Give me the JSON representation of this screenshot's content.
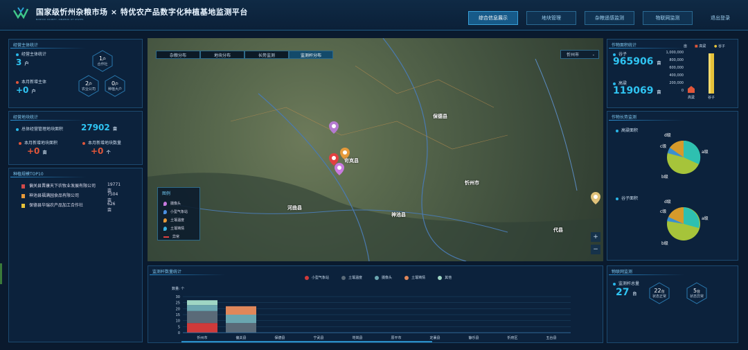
{
  "header": {
    "title": "国家级忻州杂粮市场 × 特优农产品数字化种植基地监测平台",
    "subtitle": "BANYOU COUNTY, XINZHOU OF STATES",
    "nav": [
      "综合信息展示",
      "地块管理",
      "杂粮遥感监测",
      "物联网监测",
      "退出登录"
    ]
  },
  "business": {
    "title": "经营主体统计",
    "total_label": "经营主体统计",
    "total_value": "3",
    "total_unit": "户",
    "new_label": "本月新增主体",
    "new_value": "+0",
    "new_unit": "户",
    "coop_value": "1",
    "coop_unit": "户",
    "coop_label": "合作社",
    "company_value": "2",
    "company_unit": "户",
    "company_label": "农业公司",
    "grower_value": "0",
    "grower_unit": "户",
    "grower_label": "种植大户"
  },
  "plots": {
    "title": "经营地块统计",
    "total_label": "总体经营管理地块面积",
    "total_value": "27902",
    "total_unit": "亩",
    "new_area_label": "本月新增地块面积",
    "new_area_value": "+0",
    "new_area_unit": "亩",
    "new_count_label": "本月新增地块数量",
    "new_count_value": "+0",
    "new_count_unit": "个"
  },
  "ranking": {
    "title": "种植规模TOP10",
    "items": [
      {
        "name": "偏关县晋康天下农牧业发展有限公司",
        "value": "19771亩"
      },
      {
        "name": "神池县福满园食品有限公司",
        "value": "7504亩"
      },
      {
        "name": "保德县华瑞农产品加工合作社",
        "value": "626亩"
      }
    ]
  },
  "map": {
    "tabs": [
      "杂粮分布",
      "地块分布",
      "长势监测",
      "监测杆分布"
    ],
    "city": "忻州市",
    "legend_title": "图例",
    "legend_items": [
      "摄像头",
      "小型气象站",
      "土壤温度",
      "土壤墒情",
      "异常"
    ],
    "legend_colors": [
      "#c97adf",
      "#4a8fe0",
      "#e69a3a",
      "#3ab0e0",
      "#e04040"
    ],
    "labels": [
      "河曲县",
      "神池县",
      "岢岚县",
      "代县",
      "忻州市",
      "保德县"
    ],
    "zoom_in": "+",
    "zoom_out": "−"
  },
  "crop_area": {
    "title": "作物面积统计",
    "items": [
      {
        "name": "谷子",
        "value": "965906",
        "unit": "亩"
      },
      {
        "name": "高粱",
        "value": "119069",
        "unit": "亩"
      }
    ],
    "legend_unit": "亩",
    "legend": [
      "高粱",
      "谷子"
    ],
    "axis": [
      "1,000,000",
      "800,000",
      "600,000",
      "400,000",
      "200,000",
      "0"
    ]
  },
  "crop_growth": {
    "title": "作物长势监测",
    "pie1_title": "高粱面积",
    "pie2_title": "谷子面积",
    "labels": [
      "d级",
      "c级",
      "a级",
      "b级"
    ]
  },
  "iot": {
    "title": "物联网监测",
    "total_label": "监测杆总量",
    "total_value": "27",
    "total_unit": "台",
    "normal_value": "22",
    "normal_unit": "台",
    "normal_label": "状态正常",
    "abnormal_value": "5",
    "abnormal_unit": "台",
    "abnormal_label": "状态异常"
  },
  "chart_data": {
    "type": "bar",
    "title": "监测杆数量统计",
    "ylabel": "数量: 个",
    "categories": [
      "忻州市",
      "偏关县",
      "保德县",
      "宁武县",
      "岢岚县",
      "原平市",
      "定襄县",
      "静乐县",
      "忻府区",
      "五台县"
    ],
    "ylim": [
      0,
      30
    ],
    "yticks": [
      0,
      5,
      10,
      15,
      20,
      25,
      30
    ],
    "series": [
      {
        "name": "小型气象站",
        "color": "#d03a3a",
        "values": [
          8,
          0,
          0,
          0,
          0,
          0,
          0,
          0,
          0,
          0
        ]
      },
      {
        "name": "土壤温度",
        "color": "#5a6a78",
        "values": [
          10,
          8,
          0,
          0,
          0,
          0,
          0,
          0,
          0,
          0
        ]
      },
      {
        "name": "摄像头",
        "color": "#6aa6b0",
        "values": [
          5,
          7,
          0,
          0,
          0,
          0,
          0,
          0,
          0,
          0
        ]
      },
      {
        "name": "土壤墒情",
        "color": "#e0875a",
        "values": [
          0,
          7,
          0,
          0,
          0,
          0,
          0,
          0,
          0,
          0
        ]
      },
      {
        "name": "其他",
        "color": "#9fd6c4",
        "values": [
          4,
          0,
          0,
          0,
          0,
          0,
          0,
          0,
          0,
          0
        ]
      }
    ]
  }
}
